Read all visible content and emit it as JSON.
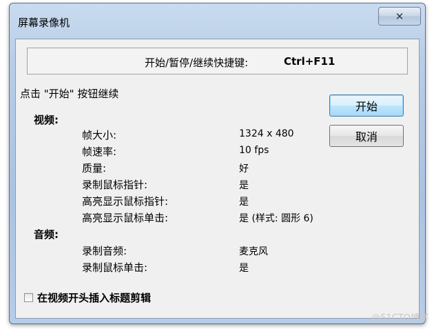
{
  "window": {
    "title": "屏幕录像机",
    "close_glyph": "✕"
  },
  "hotkey": {
    "label": "开始/暂停/继续快捷键:",
    "value": "Ctrl+F11"
  },
  "hint": "点击 \"开始\" 按钮继续",
  "video": {
    "title": "视频:",
    "rows": [
      {
        "label": "帧大小:",
        "value": "1324 x 480"
      },
      {
        "label": "帧速率:",
        "value": "10 fps"
      },
      {
        "label": "质量:",
        "value": "好"
      },
      {
        "label": "录制鼠标指针:",
        "value": "是"
      },
      {
        "label": "高亮显示鼠标指针:",
        "value": "是"
      },
      {
        "label": "高亮显示鼠标单击:",
        "value": "是 (样式: 圆形 6)"
      }
    ]
  },
  "audio": {
    "title": "音频:",
    "rows": [
      {
        "label": "录制音频:",
        "value": "麦克风"
      },
      {
        "label": "录制鼠标单击:",
        "value": "是"
      }
    ]
  },
  "buttons": {
    "start": "开始",
    "cancel": "取消"
  },
  "checkbox": {
    "label": "在视频开头插入标题剪辑",
    "checked": false
  },
  "watermark": "@51CTO博客"
}
